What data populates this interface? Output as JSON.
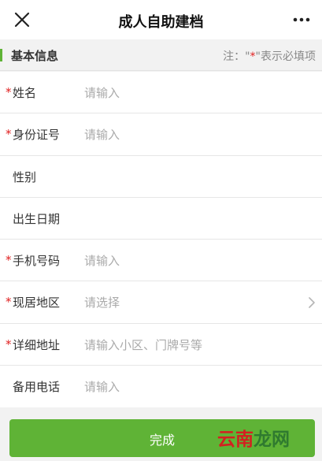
{
  "nav": {
    "title": "成人自助建档",
    "close_icon": "close-icon",
    "more_icon": "more-dots-icon"
  },
  "section": {
    "title": "基本信息",
    "note_prefix": "注：\"",
    "note_star": "*",
    "note_suffix": "\"表示必填项"
  },
  "form": {
    "required_marker": "*",
    "rows": [
      {
        "label": "姓名",
        "placeholder": "请输入",
        "required": true
      },
      {
        "label": "身份证号",
        "placeholder": "请输入",
        "required": true
      },
      {
        "label": "性别",
        "placeholder": "",
        "required": false
      },
      {
        "label": "出生日期",
        "placeholder": "",
        "required": false
      },
      {
        "label": "手机号码",
        "placeholder": "请输入",
        "required": true
      },
      {
        "label": "现居地区",
        "placeholder": "请选择",
        "required": true,
        "icon": "chevron-right-icon"
      },
      {
        "label": "详细地址",
        "placeholder": "请输入小区、门牌号等",
        "required": true
      },
      {
        "label": "备用电话",
        "placeholder": "请输入",
        "required": false
      }
    ]
  },
  "footer": {
    "done_label": "完成"
  },
  "watermark": {
    "part1": "云南",
    "part2": "龙网"
  },
  "colors": {
    "accent": "#5fb336",
    "required": "#e02020",
    "placeholder": "#aaaaaa"
  }
}
